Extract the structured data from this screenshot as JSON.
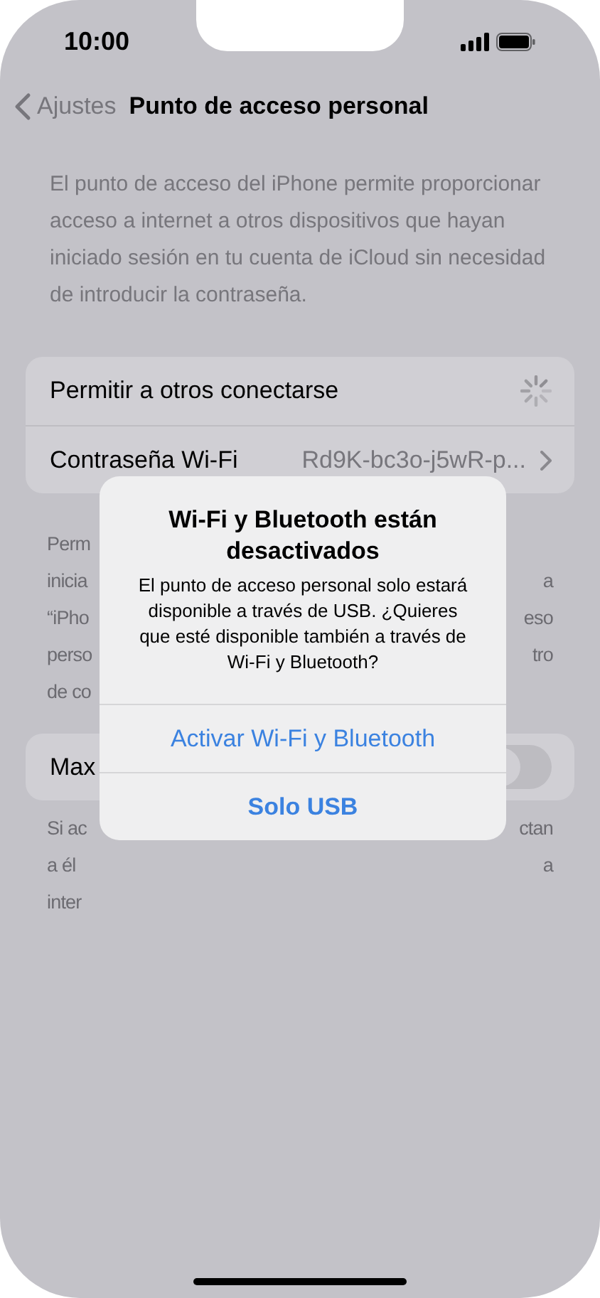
{
  "status_bar": {
    "time": "10:00"
  },
  "nav": {
    "back": "Ajustes",
    "title": "Punto de acceso personal"
  },
  "intro": "El punto de acceso del iPhone permite proporcionar acceso a internet a otros dispositivos que hayan iniciado sesión en tu cuenta de iCloud sin necesidad de introducir la contraseña.",
  "group1": [
    {
      "kind": "spinner",
      "label": "Permitir a otros conectarse"
    },
    {
      "kind": "value",
      "label": "Contraseña Wi-Fi",
      "value": "Rd9K-bc3o-j5wR-p..."
    }
  ],
  "footer1_lines": [
    {
      "left": "Perm"
    },
    {
      "left": "inicia",
      "right": "a"
    },
    {
      "left": "“iPho",
      "right": "eso"
    },
    {
      "left": "perso",
      "right": "tro"
    },
    {
      "left": "de co"
    }
  ],
  "group2": {
    "label": "Max",
    "on": false
  },
  "footer2_lines": [
    {
      "left": "Si ac",
      "right": "ctan"
    },
    {
      "left": "a él",
      "right": "a"
    },
    {
      "left": "inter"
    }
  ],
  "alert": {
    "title": "Wi-Fi y Bluetooth están desactivados",
    "message": "El punto de acceso personal solo estará disponible a través de USB. ¿Quieres que esté disponible también a través de Wi-Fi y Bluetooth?",
    "buttons": [
      {
        "label": "Activar Wi-Fi y Bluetooth",
        "bold": false
      },
      {
        "label": "Solo USB",
        "bold": true
      }
    ]
  }
}
